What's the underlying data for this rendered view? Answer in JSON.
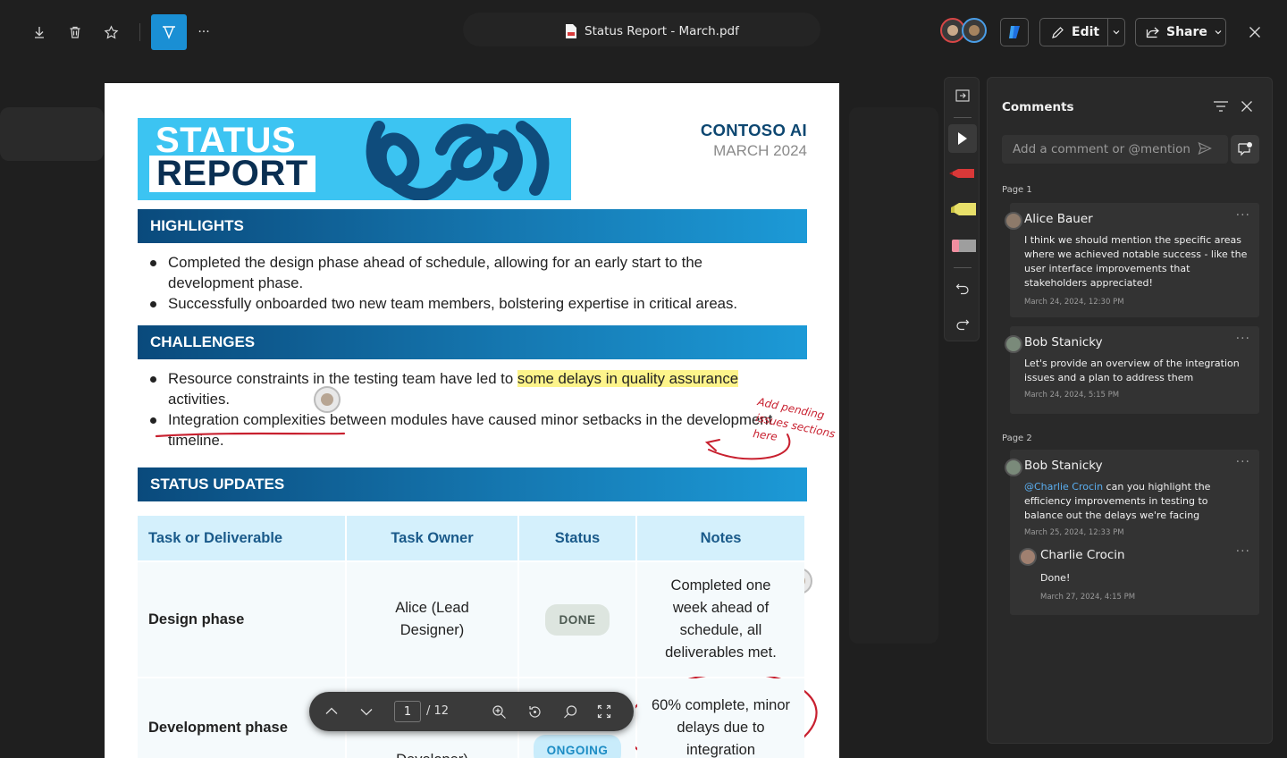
{
  "toolbar": {
    "doc_title": "Status Report - March.pdf",
    "edit_label": "Edit",
    "share_label": "Share",
    "more_label": "···"
  },
  "document": {
    "banner_line1": "STATUS",
    "banner_line2": "REPORT",
    "company": "CONTOSO AI",
    "date": "MARCH 2024",
    "highlights_title": "HIGHLIGHTS",
    "highlights": [
      "Completed the design phase ahead of schedule, allowing for an early start to the development phase.",
      "Successfully onboarded two new team members, bolstering expertise in critical areas."
    ],
    "challenges_title": "CHALLENGES",
    "challenge1_pre": "Resource constraints in the testing team have led to ",
    "challenge1_highlight": "some delays in quality assurance",
    "challenge1_post": " activities.",
    "challenge2": "Integration complexities between modules have caused minor setbacks in the development timeline.",
    "ink_note": [
      "Add pending",
      "issues sections",
      "here"
    ],
    "status_title": "STATUS UPDATES",
    "table_headers": [
      "Task or Deliverable",
      "Task Owner",
      "Status",
      "Notes"
    ],
    "row1": {
      "task": "Design phase",
      "owner": "Alice (Lead Designer)",
      "status": "DONE",
      "notes": "Completed one week ahead of schedule, all deliverables met."
    },
    "row2": {
      "task": "Development phase",
      "owner": "Developer)",
      "status": "ONGOING",
      "notes": "60% complete, minor delays due to integration"
    }
  },
  "pdf_nav": {
    "page": "1",
    "total": "/ 12"
  },
  "comments": {
    "title": "Comments",
    "placeholder": "Add a comment or @mention",
    "page1_label": "Page 1",
    "page2_label": "Page 2",
    "c1": {
      "name": "Alice Bauer",
      "text": "I think we should mention the specific areas where we achieved notable success - like the user interface improvements that stakeholders appreciated!",
      "time": "March 24, 2024, 12:30 PM"
    },
    "c2": {
      "name": "Bob Stanicky",
      "text": "Let's provide an overview of the integration issues and a plan to address them",
      "time": "March 24, 2024, 5:15 PM"
    },
    "c3": {
      "name": "Bob Stanicky",
      "mention": "@Charlie Crocin",
      "text": " can you highlight the efficiency improvements in testing to balance out the delays we're facing",
      "time": "March 25, 2024, 12:33 PM"
    },
    "c4": {
      "name": "Charlie Crocin",
      "text": "Done!",
      "time": "March 27, 2024, 4:15 PM"
    }
  },
  "colors": {
    "accent": "#1a8fd4",
    "banner": "#3cc4f2",
    "ink": "#c8202f",
    "highlight": "#fdf48b"
  }
}
